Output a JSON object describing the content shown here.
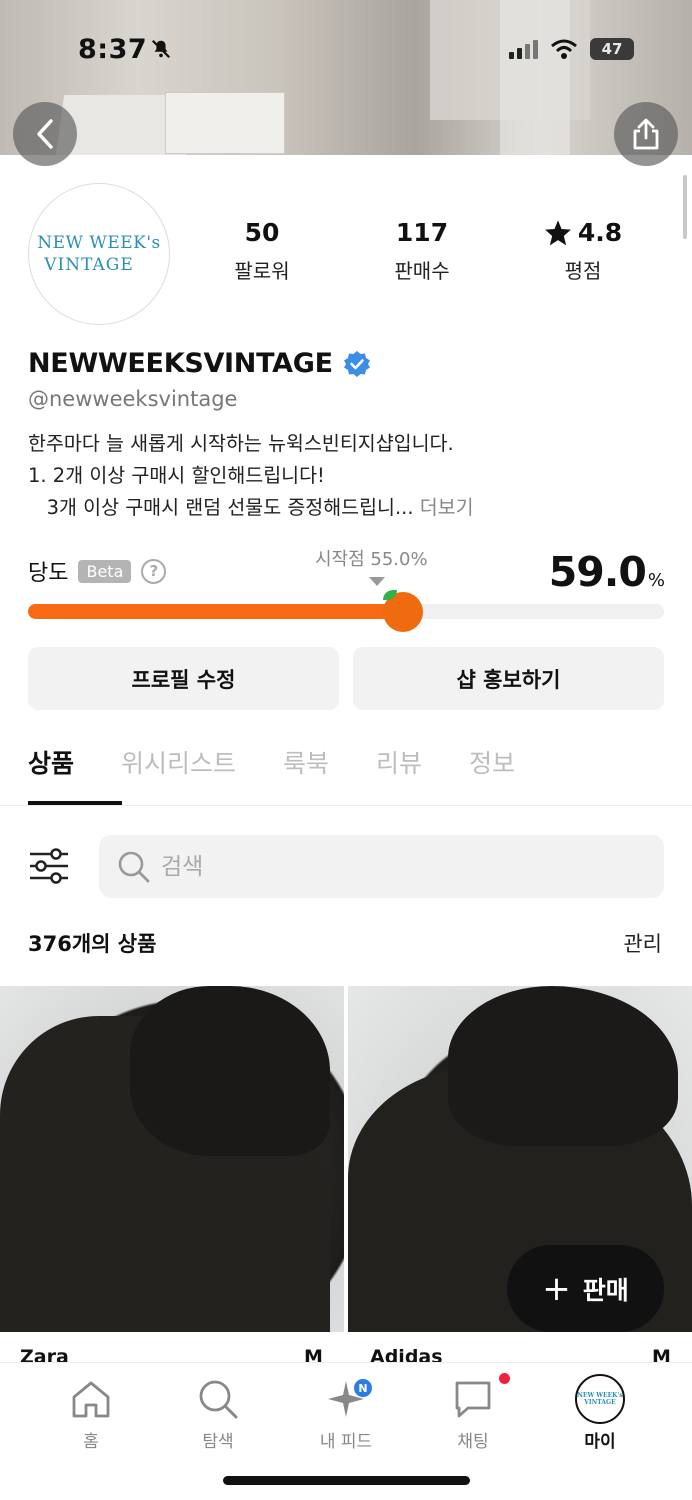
{
  "status_bar": {
    "time": "8:37",
    "battery": "47"
  },
  "profile": {
    "avatar_line1": "NEW WEEK's",
    "avatar_line2": "VINTAGE",
    "stats": [
      {
        "value": "50",
        "label": "팔로워"
      },
      {
        "value": "117",
        "label": "판매수"
      },
      {
        "value": "4.8",
        "label": "평점"
      }
    ],
    "shop_name": "NEWWEEKSVINTAGE",
    "handle": "@newweeksvintage",
    "bio_line1": "한주마다 늘 새롭게 시작하는 뉴윅스빈티지샵입니다.",
    "bio_line2": "1. 2개 이상 구매시 할인해드립니다!",
    "bio_line3": "   3개 이상 구매시 랜덤 선물도 증정해드립니...",
    "bio_more": "더보기"
  },
  "sweetness": {
    "label": "당도",
    "beta": "Beta",
    "help": "?",
    "start_text": "시작점 55.0%",
    "value": "59.0",
    "unit": "%",
    "fraction": 0.59,
    "start_fraction": 0.55,
    "colors": {
      "fill": "#fa6a14",
      "track": "#f0f0f0"
    }
  },
  "actions": {
    "edit_profile": "프로필 수정",
    "promote_shop": "샵 홍보하기"
  },
  "tabs": [
    {
      "label": "상품",
      "active": true
    },
    {
      "label": "위시리스트",
      "active": false
    },
    {
      "label": "룩북",
      "active": false
    },
    {
      "label": "리뷰",
      "active": false
    },
    {
      "label": "정보",
      "active": false
    }
  ],
  "search": {
    "placeholder": "검색"
  },
  "listing": {
    "count_text": "376개의 상품",
    "manage": "관리"
  },
  "products": [
    {
      "brand": "Zara",
      "size": "M"
    },
    {
      "brand": "Adidas",
      "size": "M"
    }
  ],
  "fab": {
    "plus": "+",
    "label": "판매"
  },
  "bottom_nav": [
    {
      "label": "홈",
      "icon": "home-icon"
    },
    {
      "label": "탐색",
      "icon": "search-icon"
    },
    {
      "label": "내 피드",
      "icon": "sparkle-icon",
      "badge": "N"
    },
    {
      "label": "채팅",
      "icon": "chat-icon"
    },
    {
      "label": "마이",
      "icon": "avatar",
      "active": true
    }
  ]
}
